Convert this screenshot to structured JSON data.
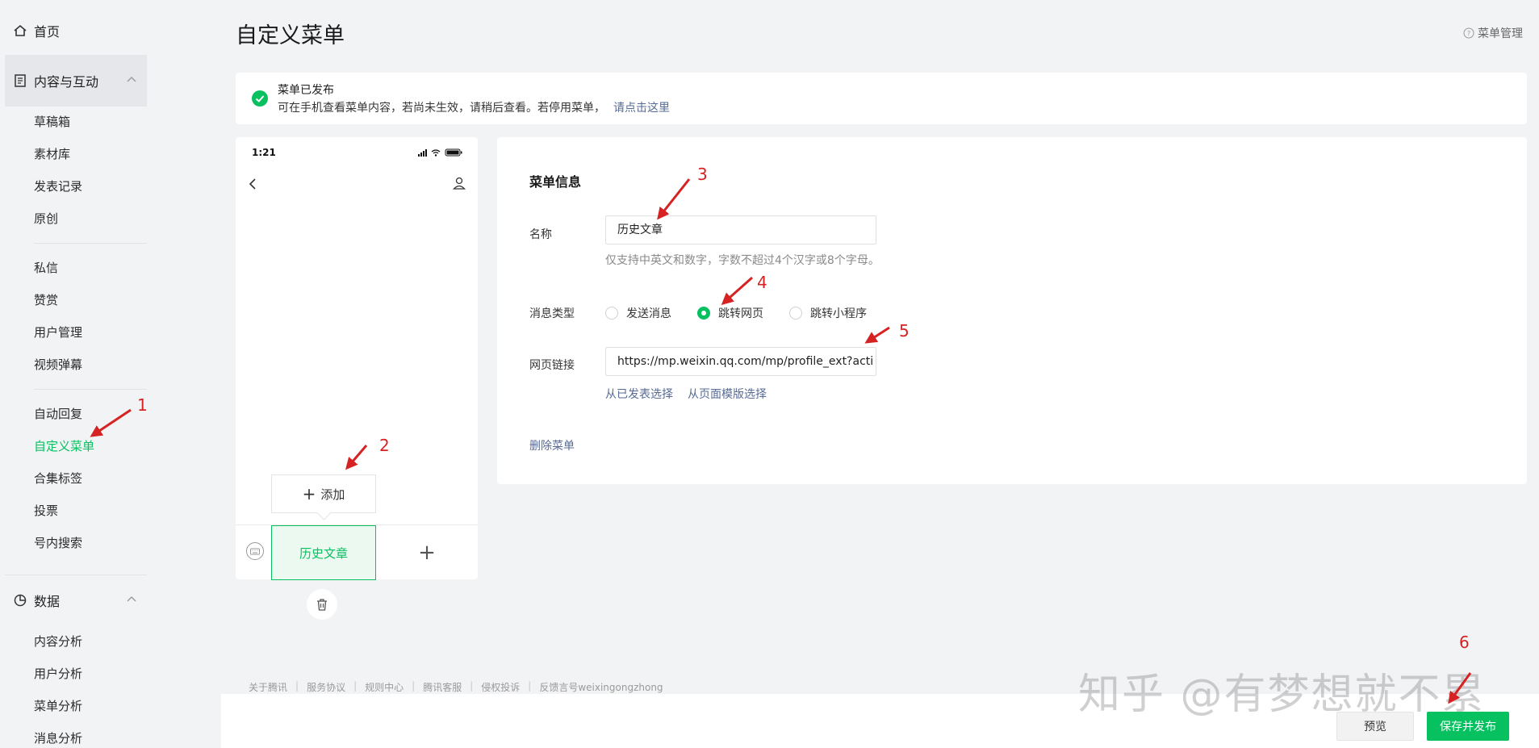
{
  "sidebar": {
    "home": "首页",
    "content_group": "内容与互动",
    "content_items": [
      "草稿箱",
      "素材库",
      "发表记录",
      "原创"
    ],
    "message_items": [
      "私信",
      "赞赏",
      "用户管理",
      "视频弹幕"
    ],
    "tools_items": [
      "自动回复",
      "自定义菜单",
      "合集标签",
      "投票",
      "号内搜索"
    ],
    "data_group": "数据",
    "data_items": [
      "内容分析",
      "用户分析",
      "菜单分析",
      "消息分析"
    ]
  },
  "header": {
    "title": "自定义菜单",
    "help": "菜单管理"
  },
  "notice": {
    "title": "菜单已发布",
    "text": "可在手机查看菜单内容，若尚未生效，请稍后查看。若停用菜单，",
    "link": "请点击这里"
  },
  "phone": {
    "time": "1:21",
    "add_label": "添加",
    "menu_item": "历史文章",
    "add_symbol": "+"
  },
  "form": {
    "section_title": "菜单信息",
    "name_label": "名称",
    "name_value": "历史文章",
    "name_hint": "仅支持中英文和数字，字数不超过4个汉字或8个字母。",
    "type_label": "消息类型",
    "options": [
      "发送消息",
      "跳转网页",
      "跳转小程序"
    ],
    "selected_option": "跳转网页",
    "url_label": "网页链接",
    "url_value": "https://mp.weixin.qq.com/mp/profile_ext?acti",
    "link_published": "从已发表选择",
    "link_template": "从页面模版选择",
    "delete": "删除菜单"
  },
  "footer": {
    "links": [
      "关于腾讯",
      "服务协议",
      "规则中心",
      "腾讯客服",
      "侵权投诉",
      "反馈言号weixingongzhong"
    ],
    "preview": "预览",
    "save": "保存并发布",
    "watermark": "知乎 @有梦想就不累"
  },
  "annotations": [
    "1",
    "2",
    "3",
    "4",
    "5",
    "6"
  ],
  "colors": {
    "brand": "#07c160",
    "link": "#576b95",
    "annotation": "#d62222"
  }
}
